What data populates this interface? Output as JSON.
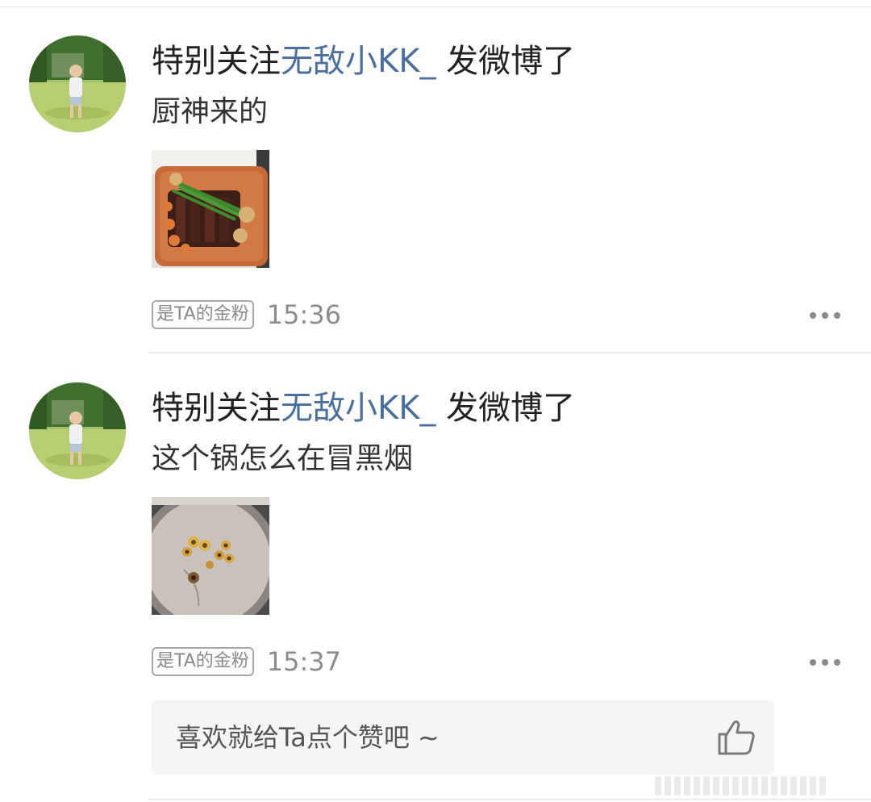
{
  "posts": [
    {
      "prefix": "特别关注",
      "username": "无敌小KK_",
      "suffix": " 发微博了",
      "text": "厨神来的",
      "image": "steak-board-photo",
      "badge": "是TA的金粉",
      "time": "15:36"
    },
    {
      "prefix": "特别关注",
      "username": "无敌小KK_",
      "suffix": " 发微博了",
      "text": "这个锅怎么在冒黑烟",
      "image": "pan-mushrooms-photo",
      "badge": "是TA的金粉",
      "time": "15:37"
    }
  ],
  "like_prompt": "喜欢就给Ta点个赞吧 ~",
  "icons": {
    "more": "more-dots-icon",
    "like": "thumbs-up-icon"
  },
  "colors": {
    "username": "#4b6f9d",
    "time": "#8c8c8c",
    "badge_border": "#a8a8a8"
  }
}
